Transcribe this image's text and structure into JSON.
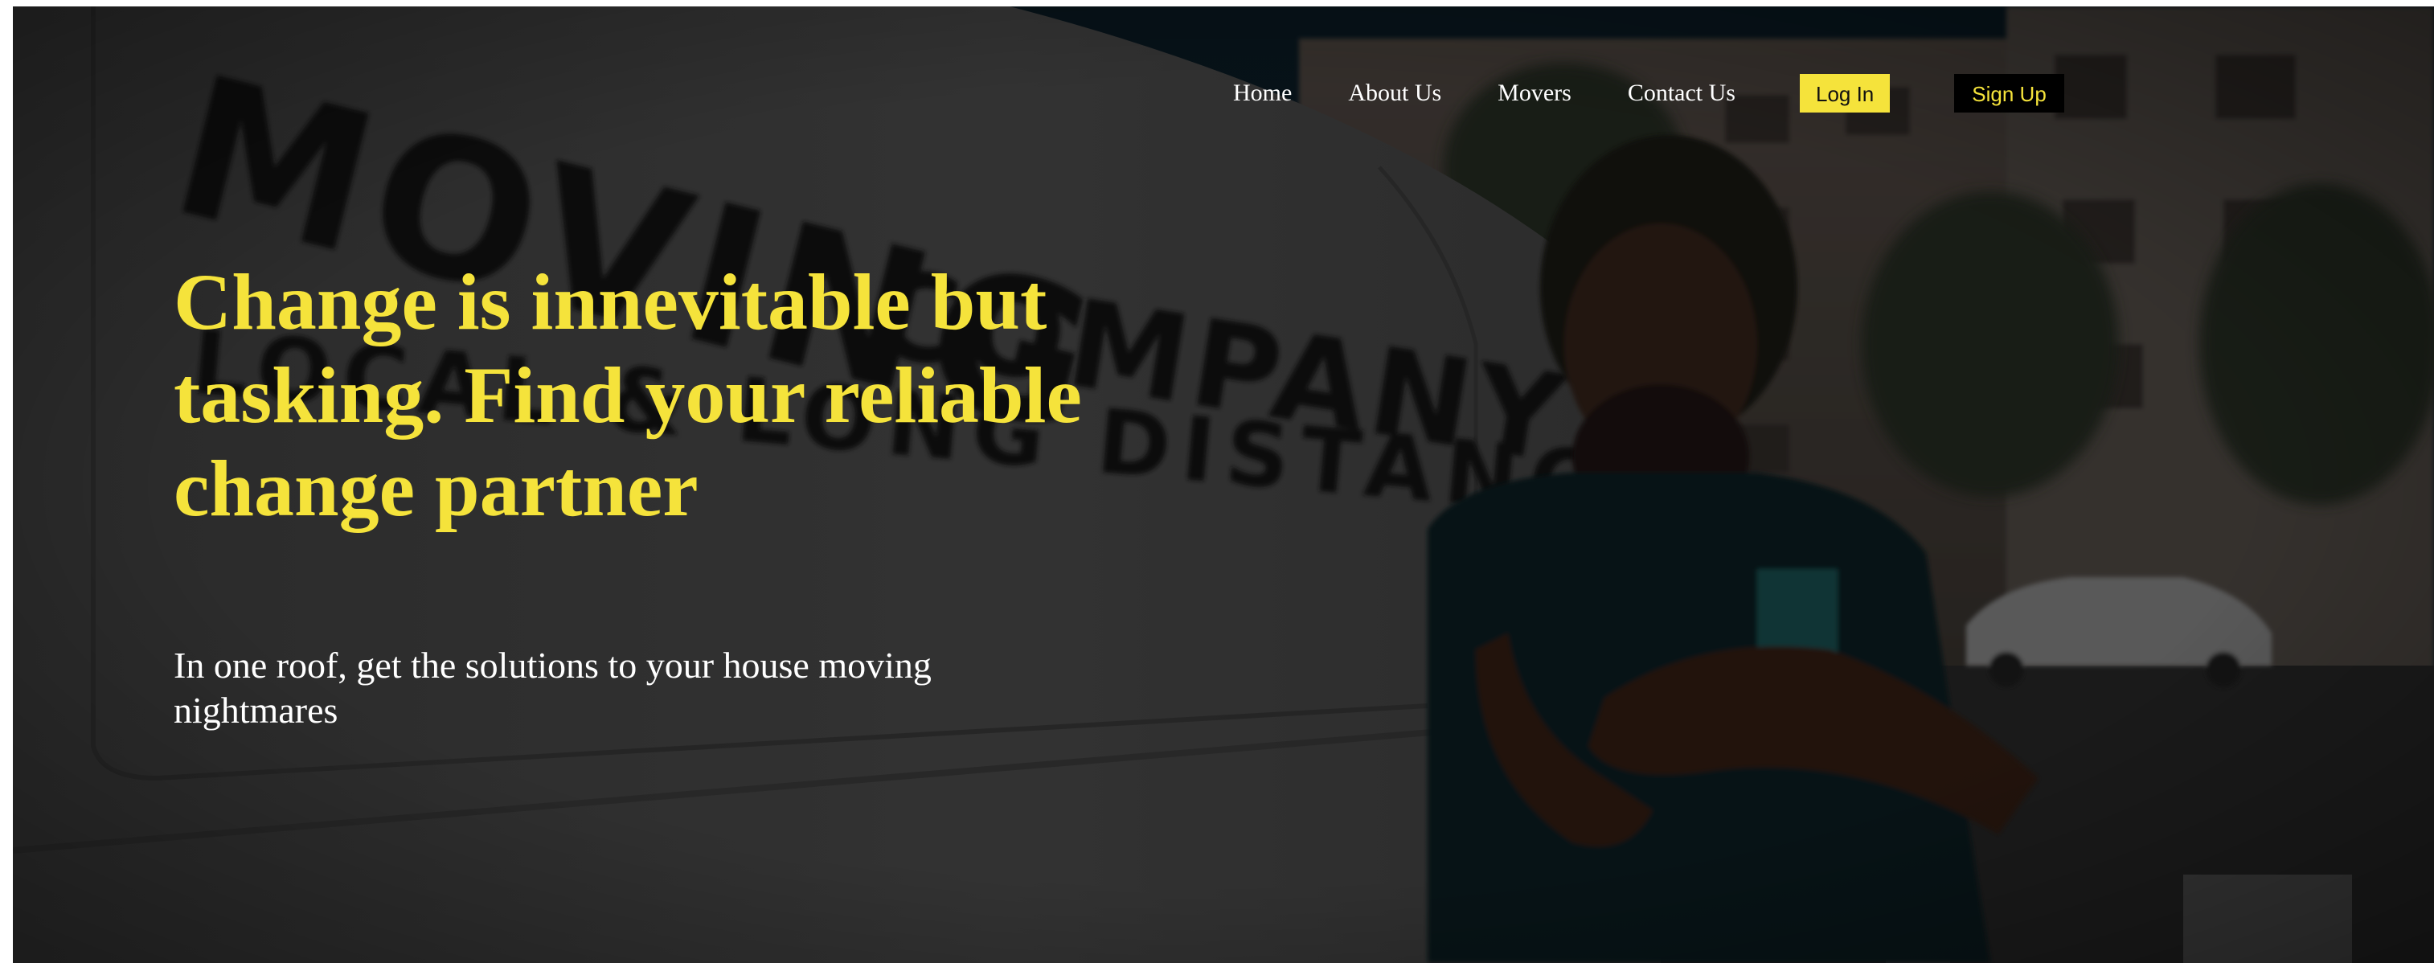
{
  "nav": {
    "links": [
      "Home",
      "About Us",
      "Movers",
      "Contact Us"
    ],
    "login_label": "Log In",
    "signup_label": "Sign Up"
  },
  "hero": {
    "headline": "Change is innevitable but tasking. Find your reliable change partner",
    "subtext": "In one roof, get the solutions to your house moving nightmares",
    "background_image": "photo of a smiling mover with crossed arms in front of a white moving van, dimmed",
    "van_lettering": [
      "MOVING COMPANY",
      "LOCAL & LONG DISTANCE"
    ]
  },
  "colors": {
    "accent": "#f5e33b",
    "overlay": "#000000",
    "text": "#ffffff"
  }
}
